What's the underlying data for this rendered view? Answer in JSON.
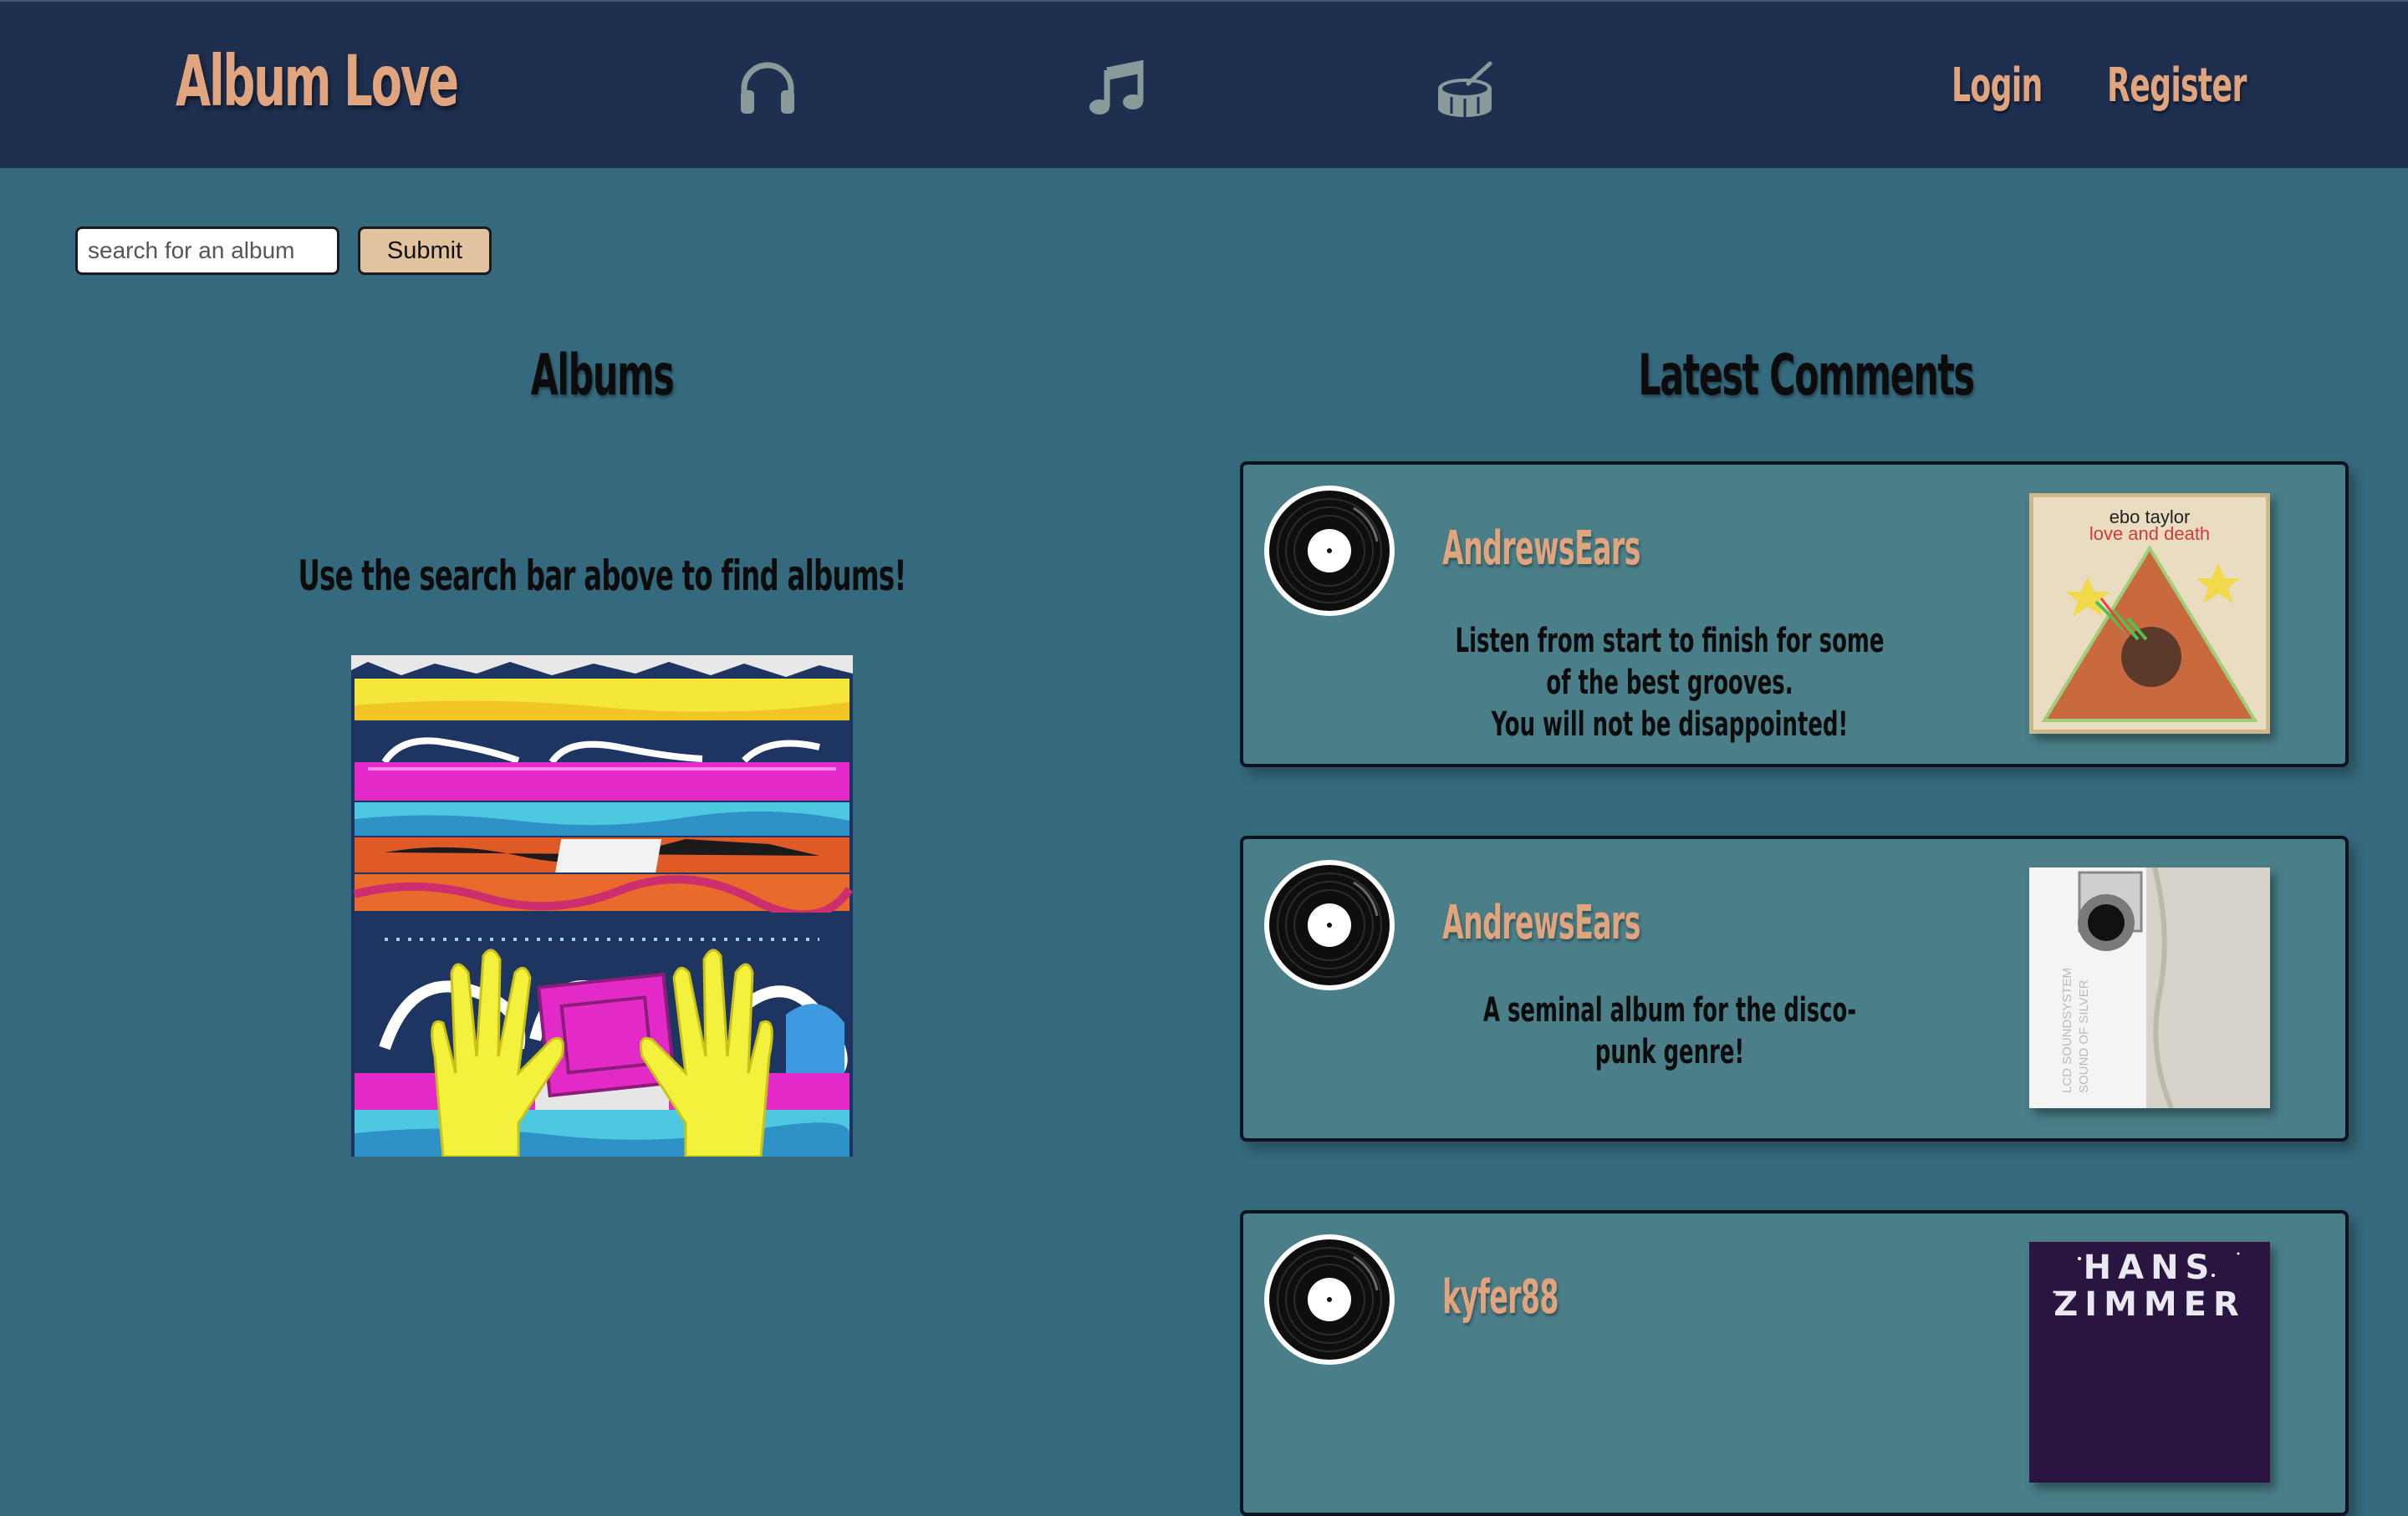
{
  "navbar": {
    "brand": "Album Love",
    "icons": [
      "headphones-icon",
      "music-note-icon",
      "drum-icon"
    ],
    "login": "Login",
    "register": "Register",
    "background": "#1e2f50",
    "accent": "#e0a47f"
  },
  "search": {
    "placeholder": "search for an album",
    "submit": "Submit"
  },
  "albums": {
    "title": "Albums",
    "hint": "Use the search bar above to find albums!"
  },
  "comments": {
    "title": "Latest Comments",
    "items": [
      {
        "user": "AndrewsEars",
        "text_lines": [
          "Listen from start to finish for some of the best grooves.",
          "You will not be disappointed!"
        ],
        "cover_artist": "ebo taylor",
        "cover_title": "love and death"
      },
      {
        "user": "AndrewsEars",
        "text_lines": [
          "A seminal album for the disco-punk genre!"
        ],
        "cover_artist": "LCD SOUNDSYSTEM",
        "cover_title": "SOUND OF SILVER"
      },
      {
        "user": "kyfer88",
        "text_lines": [],
        "cover_artist": "HANS",
        "cover_title": "ZIMMER"
      }
    ]
  }
}
